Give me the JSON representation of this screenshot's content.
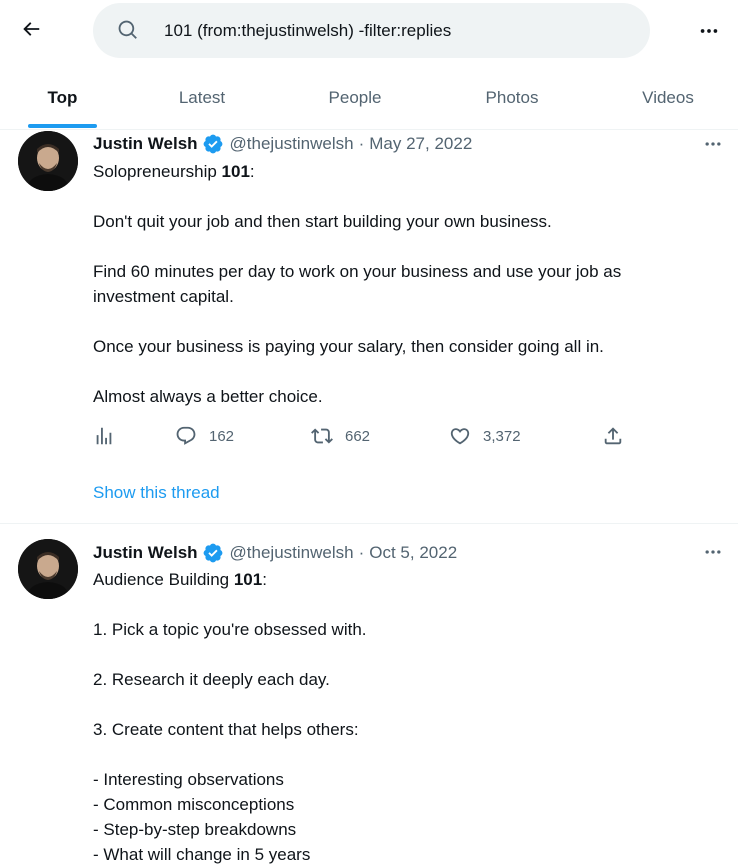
{
  "search": {
    "query": "101 (from:thejustinwelsh) -filter:replies"
  },
  "tabs": [
    {
      "label": "Top",
      "active": true
    },
    {
      "label": "Latest",
      "active": false
    },
    {
      "label": "People",
      "active": false
    },
    {
      "label": "Photos",
      "active": false
    },
    {
      "label": "Videos",
      "active": false
    }
  ],
  "tweets": [
    {
      "author": "Justin Welsh",
      "handle": "@thejustinwelsh",
      "separator": "·",
      "date": "May 27, 2022",
      "title_prefix": "Solopreneurship ",
      "title_bold": "101",
      "title_suffix": ":",
      "paragraphs": [
        "Don't quit your job and then start building your own business.",
        "Find 60 minutes per day to work on your business and use your job as",
        "investment capital.",
        "Once your business is paying your salary, then consider going all in.",
        "Almost always a better choice."
      ],
      "replies": "162",
      "retweets": "662",
      "likes": "3,372",
      "show_thread": "Show this thread"
    },
    {
      "author": "Justin Welsh",
      "handle": "@thejustinwelsh",
      "separator": "·",
      "date": "Oct 5, 2022",
      "title_prefix": "Audience Building ",
      "title_bold": "101",
      "title_suffix": ":",
      "paragraphs": [
        "1. Pick a topic you're obsessed with.",
        "2. Research it deeply each day.",
        "3. Create content that helps others:"
      ],
      "list": [
        "- Interesting observations",
        "- Common misconceptions",
        "- Step-by-step breakdowns",
        "- What will change in 5 years"
      ]
    }
  ],
  "colors": {
    "accent": "#1d9bf0",
    "text": "#0f1419",
    "secondary": "#536471",
    "search_bg": "#eff3f4"
  },
  "icons": {
    "back": "arrow-left-icon",
    "search": "search-icon",
    "more": "more-horizontal-icon",
    "verified": "verified-badge-icon",
    "views": "bar-chart-icon",
    "reply": "reply-icon",
    "retweet": "retweet-icon",
    "like": "heart-icon",
    "share": "share-icon"
  }
}
